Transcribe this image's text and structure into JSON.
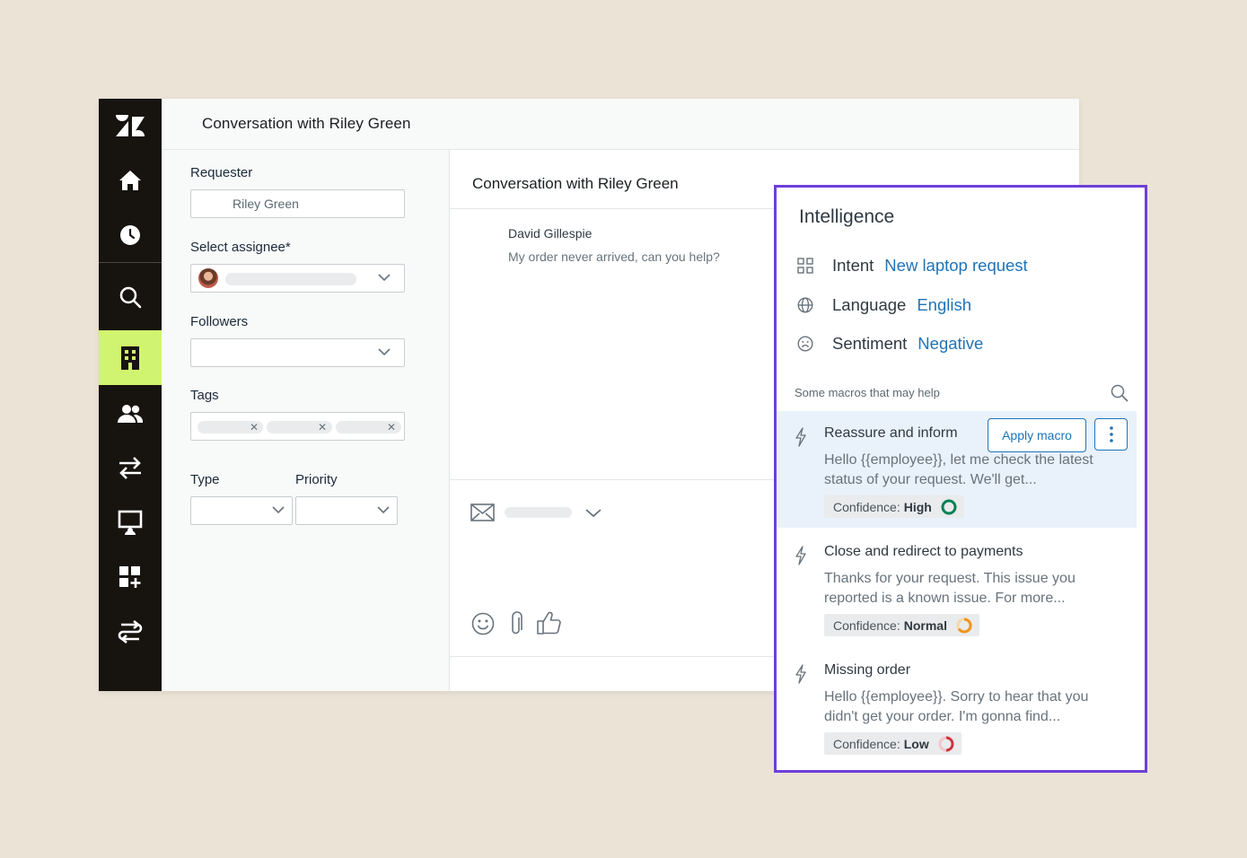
{
  "header": {
    "title": "Conversation with Riley Green"
  },
  "sidebar": {
    "items": [
      {
        "icon": "zendesk-logo-icon"
      },
      {
        "icon": "home-icon"
      },
      {
        "icon": "clock-icon"
      },
      {
        "icon": "search-icon"
      },
      {
        "icon": "building-icon",
        "active": true
      },
      {
        "icon": "users-icon"
      },
      {
        "icon": "arrows-swap-icon"
      },
      {
        "icon": "monitor-icon"
      },
      {
        "icon": "apps-add-icon"
      },
      {
        "icon": "routing-icon"
      }
    ],
    "active_color": "#d1f470"
  },
  "properties": {
    "requester_label": "Requester",
    "requester_value": "Riley Green",
    "assignee_label": "Select assignee*",
    "followers_label": "Followers",
    "tags_label": "Tags",
    "type_label": "Type",
    "priority_label": "Priority"
  },
  "conversation": {
    "title": "Conversation with Riley Green",
    "message": {
      "author": "David Gillespie",
      "text": "My order never arrived, can you help?"
    }
  },
  "intelligence": {
    "title": "Intelligence",
    "attributes": [
      {
        "key": "Intent",
        "value": "New laptop request",
        "icon": "grid-icon"
      },
      {
        "key": "Language",
        "value": "English",
        "icon": "globe-icon"
      },
      {
        "key": "Sentiment",
        "value": "Negative",
        "icon": "frown-icon"
      }
    ],
    "macros_hint": "Some macros that may help",
    "apply_label": "Apply macro",
    "macros": [
      {
        "title": "Reassure and inform",
        "body": "Hello {{employee}}, let me check the latest status of your request. We'll get...",
        "confidence_label": "Confidence:",
        "confidence": "High",
        "confidence_color": "#038153"
      },
      {
        "title": "Close and redirect to payments",
        "body": "Thanks for your request. This issue you reported is a known issue. For more...",
        "confidence_label": "Confidence:",
        "confidence": "Normal",
        "confidence_color": "#ed961c"
      },
      {
        "title": "Missing order",
        "body": "Hello {{employee}}. Sorry to hear that you didn't get your order. I'm gonna find...",
        "confidence_label": "Confidence:",
        "confidence": "Low",
        "confidence_color": "#cc3340"
      }
    ],
    "border_color": "#6e3fd9",
    "link_color": "#1f73b7"
  }
}
